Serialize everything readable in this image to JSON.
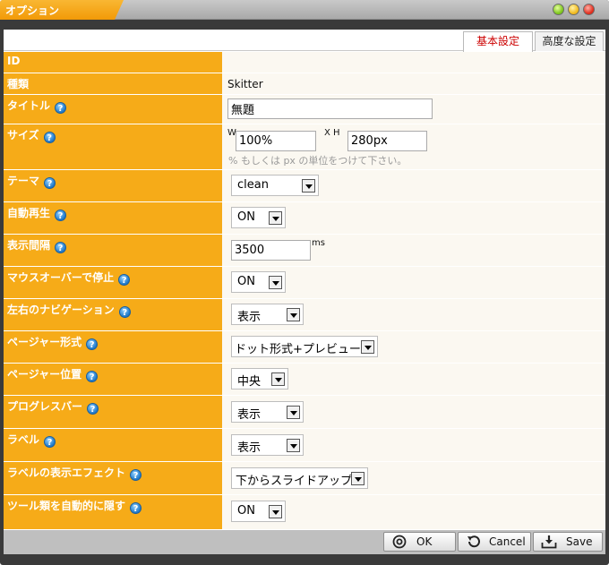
{
  "window": {
    "title": "オプション"
  },
  "tabs": [
    {
      "label": "基本設定",
      "active": true
    },
    {
      "label": "高度な設定",
      "active": false
    }
  ],
  "fields": {
    "id": {
      "label": "ID"
    },
    "type": {
      "label": "種類",
      "value": "Skitter"
    },
    "title": {
      "label": "タイトル",
      "value": "無題"
    },
    "size": {
      "label": "サイズ",
      "w_label": "W",
      "w_value": "100%",
      "h_label": "X H",
      "h_value": "280px",
      "note": "% もしくは px の単位をつけて下さい。"
    },
    "theme": {
      "label": "テーマ",
      "value": "clean"
    },
    "autoplay": {
      "label": "自動再生",
      "value": "ON"
    },
    "interval": {
      "label": "表示間隔",
      "value": "3500",
      "unit": "ms"
    },
    "hover_stop": {
      "label": "マウスオーバーで停止",
      "value": "ON"
    },
    "side_nav": {
      "label": "左右のナビゲーション",
      "value": "表示"
    },
    "pager_type": {
      "label": "ページャー形式",
      "value": "ドット形式+プレビュー"
    },
    "pager_position": {
      "label": "ページャー位置",
      "value": "中央"
    },
    "progress_bar": {
      "label": "プログレスバー",
      "value": "表示"
    },
    "label_visible": {
      "label": "ラベル",
      "value": "表示"
    },
    "label_effect": {
      "label": "ラベルの表示エフェクト",
      "value": "下からスライドアップ"
    },
    "auto_hide_tools": {
      "label": "ツール類を自動的に隠す",
      "value": "ON"
    }
  },
  "help_glyph": "?",
  "footer": {
    "ok_label": "OK",
    "cancel_label": "Cancel",
    "save_label": "Save"
  },
  "colors": {
    "accent": "#f6ab18",
    "active_tab_text": "#cc0000",
    "value_bg": "#fbf8f1"
  }
}
